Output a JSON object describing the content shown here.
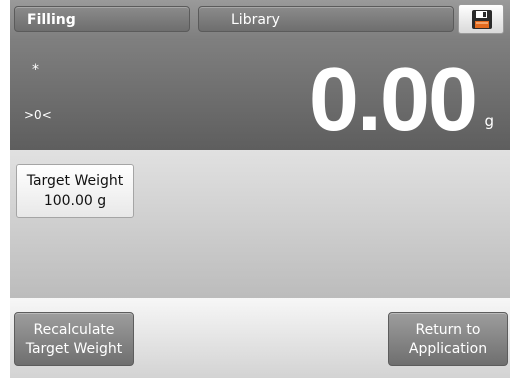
{
  "header": {
    "mode_label": "Filling",
    "library_label": "Library",
    "save_icon": "floppy-disk-icon"
  },
  "reading": {
    "stability_indicator": "*",
    "center_of_zero": ">0<",
    "value": "0.00",
    "unit": "g"
  },
  "target": {
    "label": "Target Weight",
    "value": "100.00 g"
  },
  "actions": {
    "recalculate_line1": "Recalculate",
    "recalculate_line2": "Target Weight",
    "return_line1": "Return to",
    "return_line2": "Application"
  }
}
